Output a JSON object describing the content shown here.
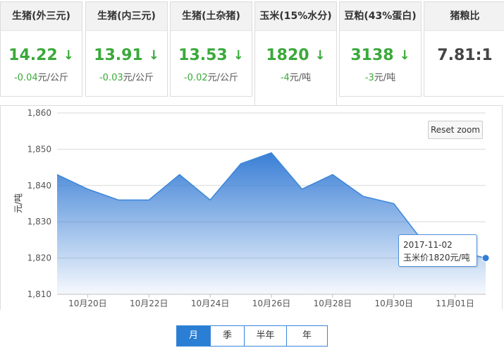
{
  "cards": [
    {
      "title": "生猪(外三元)",
      "price": "14.22",
      "arrow": "↓",
      "change": "-0.04",
      "unit": "元/公斤"
    },
    {
      "title": "生猪(内三元)",
      "price": "13.91",
      "arrow": "↓",
      "change": "-0.03",
      "unit": "元/公斤"
    },
    {
      "title": "生猪(土杂猪)",
      "price": "13.53",
      "arrow": "↓",
      "change": "-0.02",
      "unit": "元/公斤"
    },
    {
      "title": "玉米(15%水分)",
      "price": "1820",
      "arrow": "↓",
      "change": "-4",
      "unit": "元/吨"
    },
    {
      "title": "豆粕(43%蛋白)",
      "price": "3138",
      "arrow": "↓",
      "change": "-3",
      "unit": "元/吨"
    },
    {
      "title": "猪粮比",
      "ratio": "7.81:1"
    }
  ],
  "colors": {
    "down": "#3aa93a",
    "series": "#3b86d9",
    "accent": "#2a7fd4"
  },
  "chart": {
    "reset_zoom": "Reset zoom",
    "tooltip_date": "2017-11-02",
    "tooltip_value": "玉米价1820元/吨"
  },
  "chart_data": {
    "type": "area",
    "ylabel": "元/吨",
    "ylim": [
      1810,
      1860
    ],
    "yticks": [
      1810,
      1820,
      1830,
      1840,
      1850,
      1860
    ],
    "ytick_labels": [
      "1,810",
      "1,820",
      "1,830",
      "1,840",
      "1,850",
      "1,860"
    ],
    "x_tick_labels": [
      "10月20日",
      "10月22日",
      "10月24日",
      "10月26日",
      "10月28日",
      "10月30日",
      "11月01日"
    ],
    "x": [
      "2017-10-19",
      "2017-10-20",
      "2017-10-21",
      "2017-10-22",
      "2017-10-23",
      "2017-10-24",
      "2017-10-25",
      "2017-10-26",
      "2017-10-27",
      "2017-10-28",
      "2017-10-29",
      "2017-10-30",
      "2017-10-31",
      "2017-11-01",
      "2017-11-02"
    ],
    "series": [
      {
        "values": [
          1843,
          1839,
          1836,
          1836,
          1843,
          1836,
          1846,
          1849,
          1839,
          1843,
          1837,
          1835,
          1824,
          1822,
          1820
        ]
      }
    ],
    "highlight": {
      "x": "2017-11-02",
      "y": 1820
    },
    "grid": true
  },
  "tabs": [
    {
      "label": "月",
      "active": true
    },
    {
      "label": "季",
      "active": false
    },
    {
      "label": "半年",
      "active": false
    },
    {
      "label": "年",
      "active": false
    }
  ]
}
